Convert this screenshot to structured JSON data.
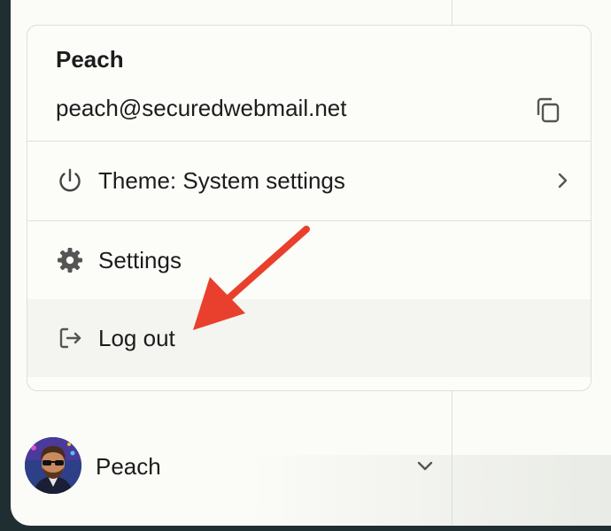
{
  "profile": {
    "name": "Peach",
    "email": "peach@securedwebmail.net",
    "copy_icon": "copy-icon"
  },
  "menu": {
    "items": [
      {
        "label": "Theme: System settings",
        "icon": "power-icon",
        "has_submenu": true
      },
      {
        "label": "Settings",
        "icon": "gear-icon"
      },
      {
        "label": "Log out",
        "icon": "logout-icon",
        "highlighted": true
      }
    ]
  },
  "account": {
    "name": "Peach",
    "icon": "chevron-down-icon"
  },
  "annotation": {
    "color": "#e8402d",
    "target": "Log out"
  },
  "colors": {
    "window_bg": "#fbfbf7",
    "menu_border": "#dededa",
    "hover_bg": "#f4f4f1",
    "outer_bg": "#1f2f31"
  }
}
